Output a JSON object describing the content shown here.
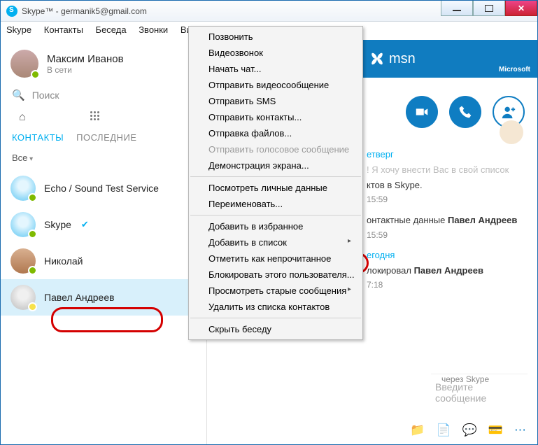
{
  "window": {
    "title": "Skype™ - germanik5@gmail.com"
  },
  "menu": {
    "items": [
      "Skype",
      "Контакты",
      "Беседа",
      "Звонки",
      "Ви"
    ]
  },
  "profile": {
    "name": "Максим Иванов",
    "status": "В сети"
  },
  "search": {
    "placeholder": "Поиск"
  },
  "tabs": {
    "contacts": "КОНТАКТЫ",
    "recent": "ПОСЛЕДНИЕ"
  },
  "filter": {
    "label": "Все"
  },
  "contacts": [
    {
      "name": "Echo / Sound Test Service",
      "avatar": "blue",
      "online": true
    },
    {
      "name": "Skype",
      "avatar": "blue",
      "online": true,
      "verified": true
    },
    {
      "name": "Николай",
      "avatar": "photo",
      "online": true
    },
    {
      "name": "Павел Андреев",
      "avatar": "grey",
      "online": false,
      "selected": true
    }
  ],
  "context_menu": {
    "items": [
      {
        "label": "Позвонить"
      },
      {
        "label": "Видеозвонок"
      },
      {
        "label": "Начать чат..."
      },
      {
        "label": "Отправить видеосообщение"
      },
      {
        "label": "Отправить SMS"
      },
      {
        "label": "Отправить контакты..."
      },
      {
        "label": "Отправка файлов..."
      },
      {
        "label": "Отправить голосовое сообщение",
        "disabled": true
      },
      {
        "label": "Демонстрация экрана..."
      },
      {
        "sep": true
      },
      {
        "label": "Посмотреть личные данные"
      },
      {
        "label": "Переименовать..."
      },
      {
        "sep": true
      },
      {
        "label": "Добавить в избранное"
      },
      {
        "label": "Добавить в список",
        "arrow": true
      },
      {
        "label": "Отметить как непрочитанное"
      },
      {
        "label": "Блокировать этого пользователя..."
      },
      {
        "label": "Просмотреть старые сообщения",
        "arrow": true
      },
      {
        "label": "Удалить из списка контактов"
      },
      {
        "sep": true
      },
      {
        "label": "Скрыть беседу"
      }
    ]
  },
  "banner": {
    "logo": "msn",
    "company": "Microsoft"
  },
  "chat": {
    "day1": "етверг",
    "l1a": "! Я хочу внести Вас в свой список",
    "l1b": "ктов в Skype.",
    "t1": "15:59",
    "l2a": "онтактные данные ",
    "l2b": "Павел Андреев",
    "t2": "15:59",
    "day2": "егодня",
    "l3a": "локировал ",
    "l3b": "Павел Андреев",
    "t3": "7:18",
    "source": "через Skype",
    "input_placeholder": "Введите сообщение"
  },
  "icons": {
    "home": "home-icon",
    "dialpad": "dialpad-icon",
    "video": "video-icon",
    "call": "phone-icon",
    "add": "add-contact-icon",
    "attach": "folder-icon",
    "file": "file-icon",
    "chatb": "chat-icon",
    "card": "card-icon",
    "more": "more-icon"
  }
}
